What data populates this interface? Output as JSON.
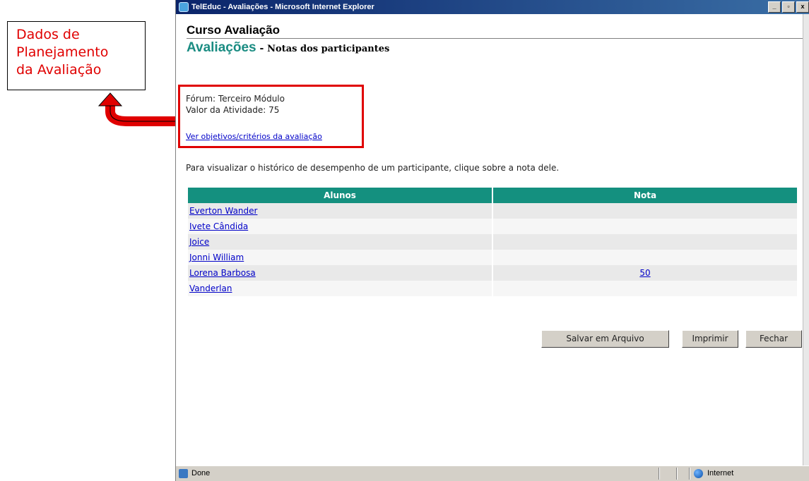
{
  "annotation": {
    "lines": [
      "Dados de",
      "Planejamento",
      "da Avaliação"
    ]
  },
  "window": {
    "title": "TelEduc - Avaliações - Microsoft Internet Explorer",
    "buttons": [
      "_",
      "▫",
      "x"
    ]
  },
  "page": {
    "course_title": "Curso Avaliação",
    "section_title": "Avaliações",
    "section_separator": " - ",
    "section_subtitle": "Notas dos participantes",
    "forum": "Fórum: Terceiro Módulo",
    "activity_value": "Valor da Atividade: 75",
    "objectives_link": "Ver objetivos/critérios da avaliação",
    "instruction": "Para visualizar o histórico de desempenho de um participante, clique sobre a nota dele."
  },
  "table": {
    "headers": [
      "Alunos",
      "Nota"
    ],
    "rows": [
      {
        "name": "Everton Wander",
        "grade": ""
      },
      {
        "name": "Ivete Cândida",
        "grade": ""
      },
      {
        "name": "Joice",
        "grade": ""
      },
      {
        "name": "Jonni William",
        "grade": ""
      },
      {
        "name": "Lorena Barbosa",
        "grade": "50"
      },
      {
        "name": "Vanderlan",
        "grade": ""
      }
    ]
  },
  "buttons": {
    "save": "Salvar em Arquivo",
    "print": "Imprimir",
    "close": "Fechar"
  },
  "status": {
    "text": "Done",
    "zone": "Internet"
  },
  "colors": {
    "accent": "#14907f",
    "title_green": "#1a8c82",
    "highlight_red": "#e00000",
    "link": "#0000c8"
  }
}
